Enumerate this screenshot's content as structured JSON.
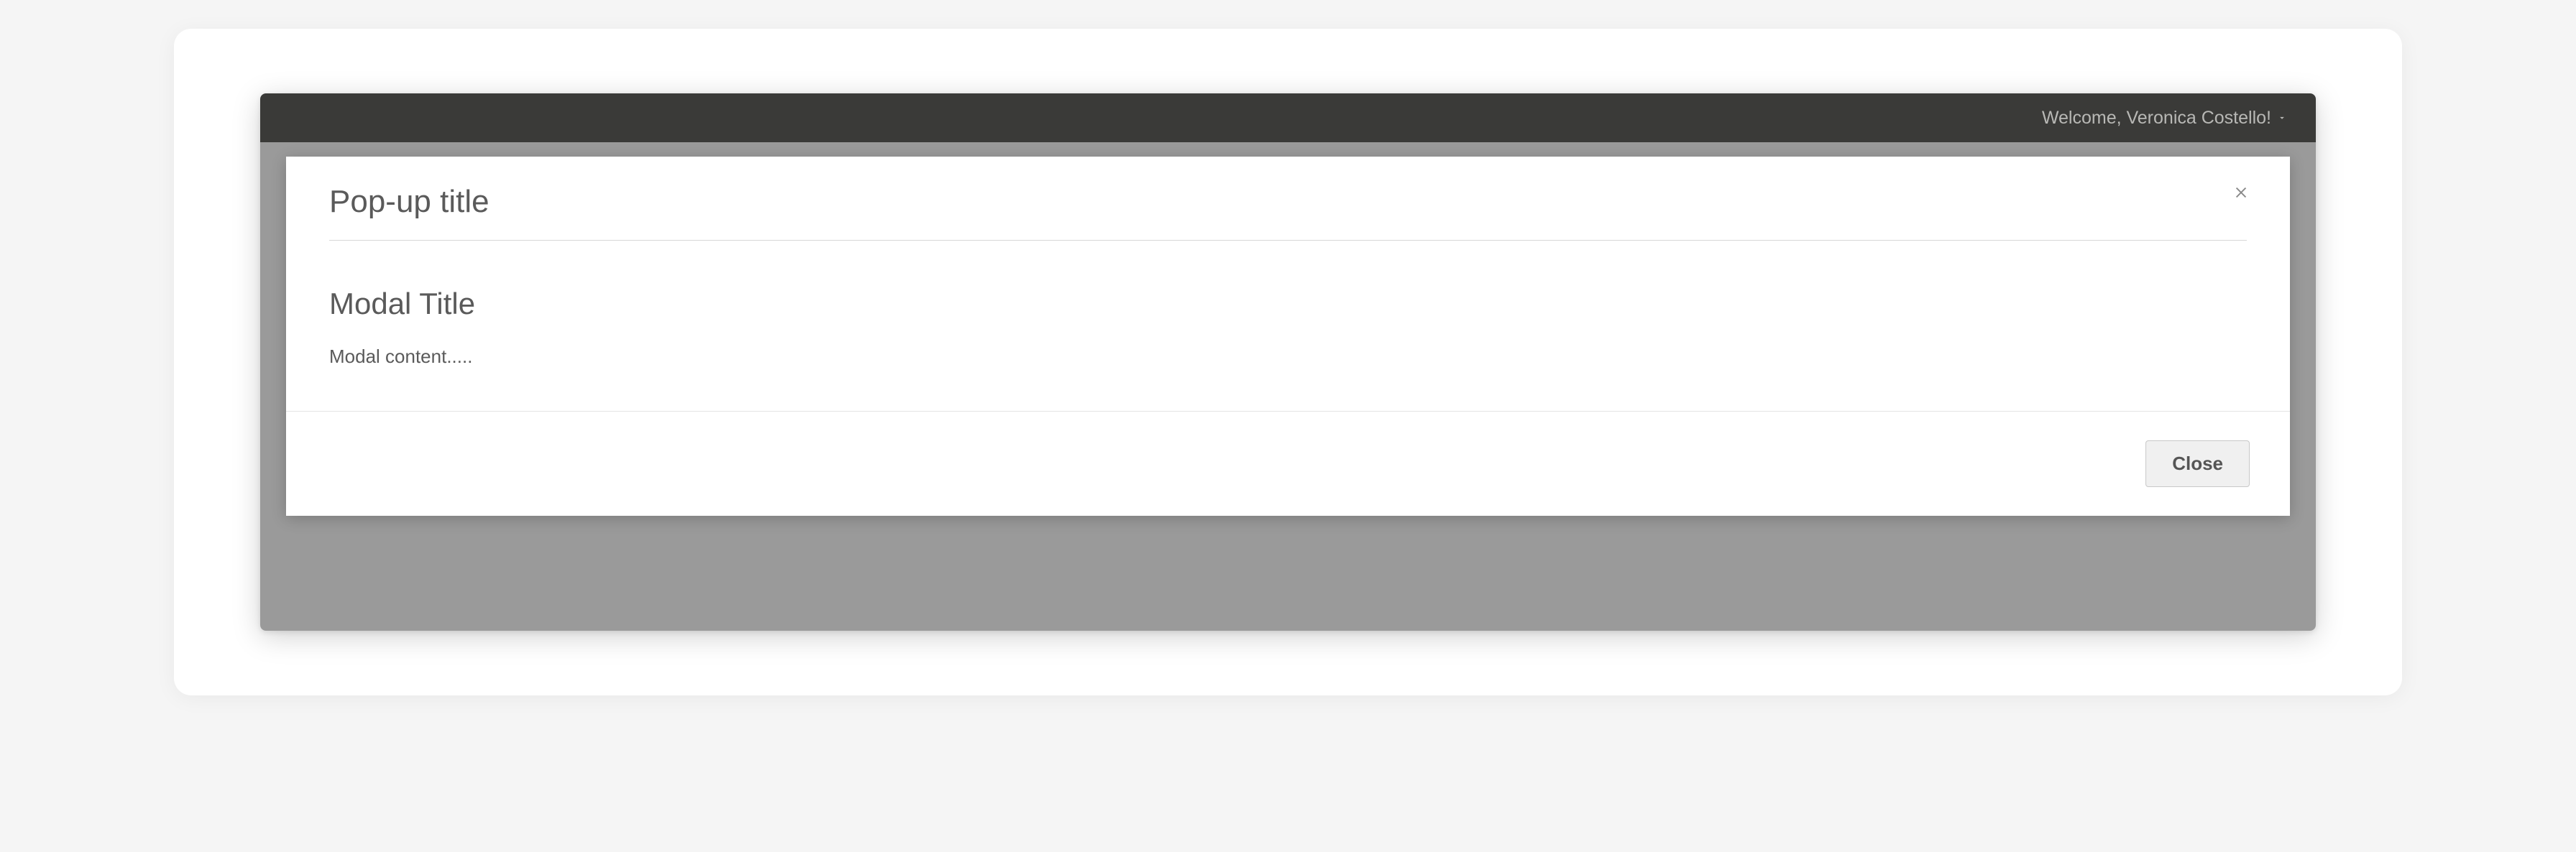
{
  "header": {
    "welcome": "Welcome, Veronica Costello!"
  },
  "modal": {
    "popup_title": "Pop-up title",
    "title": "Modal Title",
    "content": "Modal content.....",
    "close_button": "Close"
  }
}
